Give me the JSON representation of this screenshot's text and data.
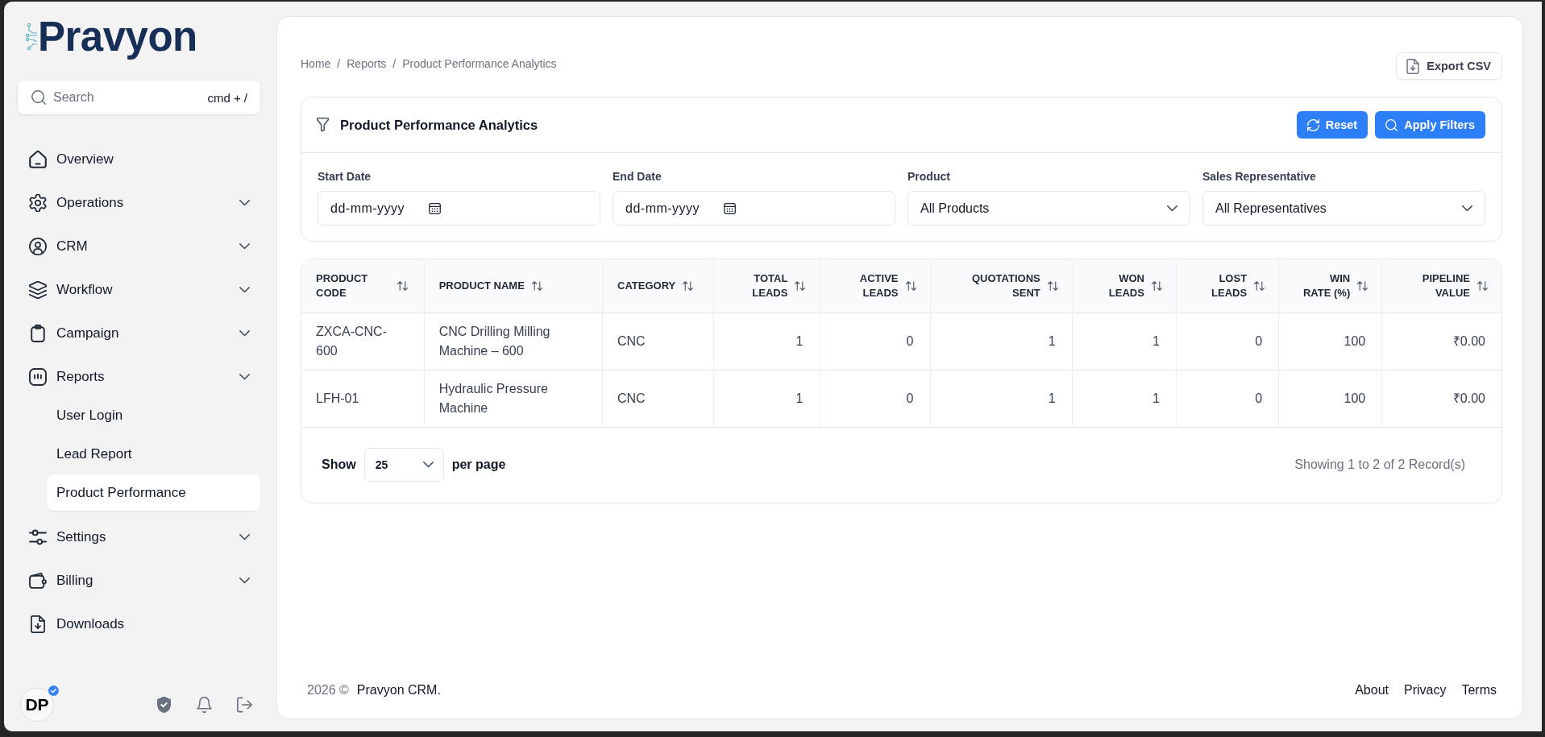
{
  "sidebar": {
    "logo": "Pravyon",
    "search": {
      "placeholder": "Search",
      "shortcut": "cmd + /"
    },
    "items": [
      {
        "label": "Overview",
        "kind": "link",
        "selected": false
      },
      {
        "label": "Operations",
        "kind": "group",
        "selected": false
      },
      {
        "label": "CRM",
        "kind": "group",
        "selected": false
      },
      {
        "label": "Workflow",
        "kind": "group",
        "selected": false
      },
      {
        "label": "Campaign",
        "kind": "group",
        "selected": false
      },
      {
        "label": "Reports",
        "kind": "group",
        "selected": false,
        "children": [
          {
            "label": "User Login",
            "selected": false
          },
          {
            "label": "Lead Report",
            "selected": false
          },
          {
            "label": "Product Performance",
            "selected": true
          }
        ]
      },
      {
        "label": "Settings",
        "kind": "group",
        "selected": false
      },
      {
        "label": "Billing",
        "kind": "group",
        "selected": false
      },
      {
        "label": "Downloads",
        "kind": "link",
        "selected": false
      }
    ],
    "user": {
      "initials": "DP",
      "verified": true
    }
  },
  "breadcrumb": {
    "separator": "/",
    "items": [
      "Home",
      "Reports",
      "Product Performance Analytics"
    ]
  },
  "export_button": "Export CSV",
  "filters": {
    "title": "Product Performance Analytics",
    "buttons": [
      "Reset",
      "Apply Filters"
    ],
    "fields": [
      {
        "label": "Start Date",
        "kind": "date",
        "placeholder": "dd-mm-yyyy"
      },
      {
        "label": "End Date",
        "kind": "date",
        "placeholder": "dd-mm-yyyy"
      },
      {
        "label": "Product",
        "kind": "select",
        "value": "All Products"
      },
      {
        "label": "Sales Representative",
        "kind": "select",
        "value": "All Representatives"
      }
    ]
  },
  "table": {
    "columns": [
      {
        "label": "PRODUCT CODE",
        "kind": "text"
      },
      {
        "label": "PRODUCT NAME",
        "kind": "text"
      },
      {
        "label": "CATEGORY",
        "kind": "text"
      },
      {
        "label": "TOTAL LEADS",
        "kind": "number"
      },
      {
        "label": "ACTIVE LEADS",
        "kind": "number"
      },
      {
        "label": "QUOTATIONS SENT",
        "kind": "number"
      },
      {
        "label": "WON LEADS",
        "kind": "number"
      },
      {
        "label": "LOST LEADS",
        "kind": "number"
      },
      {
        "label": "WIN RATE (%)",
        "kind": "number"
      },
      {
        "label": "PIPELINE VALUE",
        "kind": "number"
      }
    ],
    "rows": [
      [
        "ZXCA-CNC-600",
        "CNC Drilling Milling Machine – 600",
        "CNC",
        "1",
        "0",
        "1",
        "1",
        "0",
        "100",
        "₹0.00"
      ],
      [
        "LFH-01",
        "Hydraulic Pressure Machine",
        "CNC",
        "1",
        "0",
        "1",
        "1",
        "0",
        "100",
        "₹0.00"
      ]
    ]
  },
  "pagination": {
    "show_label": "Show",
    "page_size": "25",
    "per_page_label": "per page",
    "summary": "Showing 1 to 2 of 2 Record(s)"
  },
  "footer": {
    "copyright": "2026 ©",
    "company": "Pravyon CRM.",
    "links": [
      "About",
      "Privacy",
      "Terms"
    ]
  }
}
